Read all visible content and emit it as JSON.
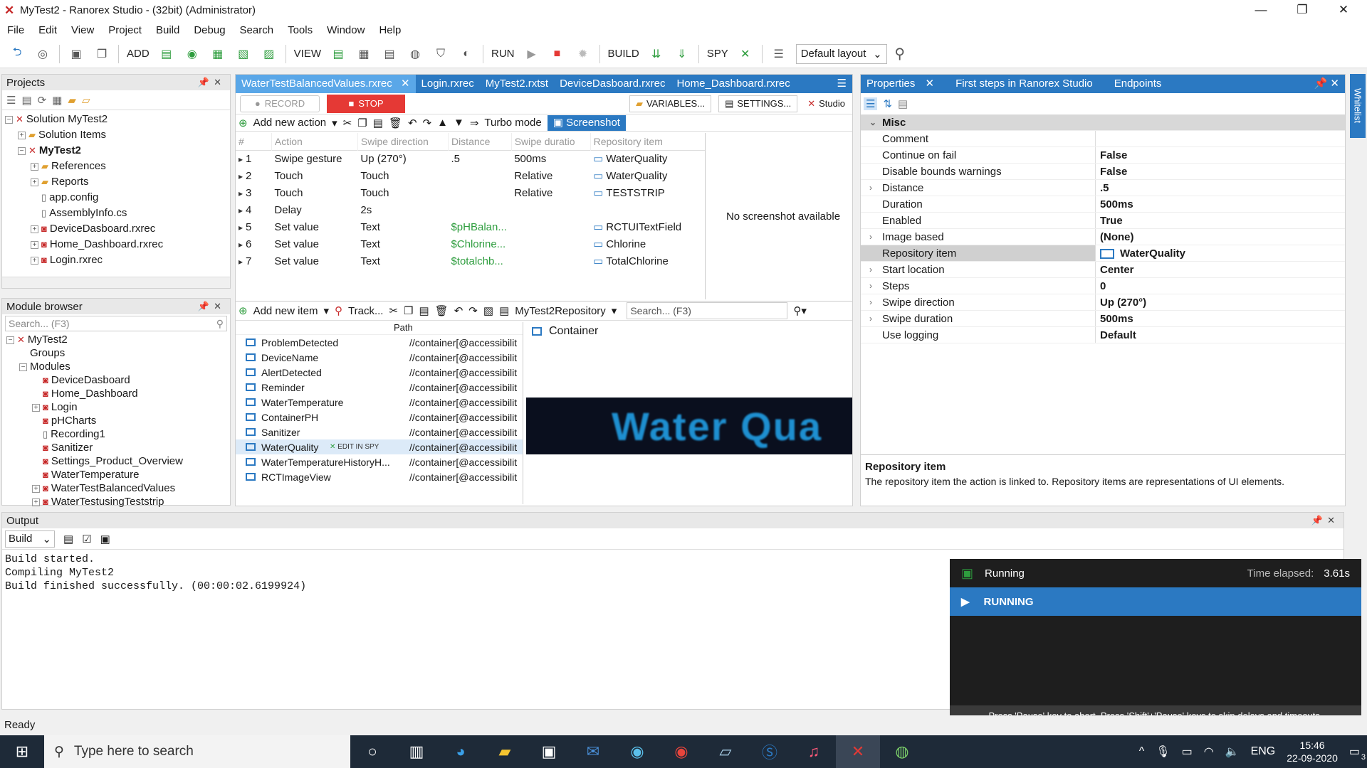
{
  "window": {
    "title": "MyTest2 - Ranorex Studio - (32bit) (Administrator)",
    "app_icon": "ranorex-icon"
  },
  "menu": [
    "File",
    "Edit",
    "View",
    "Project",
    "Build",
    "Debug",
    "Search",
    "Tools",
    "Window",
    "Help"
  ],
  "toolbar": {
    "add": "ADD",
    "view": "VIEW",
    "run": "RUN",
    "build": "BUILD",
    "spy": "SPY",
    "layout": "Default layout"
  },
  "projects": {
    "header": "Projects",
    "tree": [
      {
        "label": "Solution MyTest2",
        "indent": 0,
        "icon": "solution",
        "exp": "−",
        "bold": false
      },
      {
        "label": "Solution Items",
        "indent": 1,
        "icon": "folder",
        "exp": "+",
        "bold": false
      },
      {
        "label": "MyTest2",
        "indent": 1,
        "icon": "project",
        "exp": "−",
        "bold": true
      },
      {
        "label": "References",
        "indent": 2,
        "icon": "folder",
        "exp": "+",
        "bold": false
      },
      {
        "label": "Reports",
        "indent": 2,
        "icon": "folder",
        "exp": "+",
        "bold": false
      },
      {
        "label": "app.config",
        "indent": 2,
        "icon": "file",
        "exp": "",
        "bold": false
      },
      {
        "label": "AssemblyInfo.cs",
        "indent": 2,
        "icon": "file",
        "exp": "",
        "bold": false
      },
      {
        "label": "DeviceDasboard.rxrec",
        "indent": 2,
        "icon": "rec",
        "exp": "+",
        "bold": false
      },
      {
        "label": "Home_Dashboard.rxrec",
        "indent": 2,
        "icon": "rec",
        "exp": "+",
        "bold": false
      },
      {
        "label": "Login.rxrec",
        "indent": 2,
        "icon": "rec",
        "exp": "+",
        "bold": false
      }
    ]
  },
  "module_browser": {
    "header": "Module browser",
    "search_placeholder": "Search... (F3)",
    "tree": [
      {
        "label": "MyTest2",
        "indent": 0,
        "exp": "−",
        "icon": "project"
      },
      {
        "label": "Groups",
        "indent": 1,
        "exp": "",
        "icon": ""
      },
      {
        "label": "Modules",
        "indent": 1,
        "exp": "−",
        "icon": ""
      },
      {
        "label": "DeviceDasboard",
        "indent": 2,
        "exp": "",
        "icon": "rec"
      },
      {
        "label": "Home_Dashboard",
        "indent": 2,
        "exp": "",
        "icon": "rec"
      },
      {
        "label": "Login",
        "indent": 2,
        "exp": "+",
        "icon": "rec"
      },
      {
        "label": "pHCharts",
        "indent": 2,
        "exp": "",
        "icon": "rec"
      },
      {
        "label": "Recording1",
        "indent": 2,
        "exp": "",
        "icon": "file"
      },
      {
        "label": "Sanitizer",
        "indent": 2,
        "exp": "",
        "icon": "rec"
      },
      {
        "label": "Settings_Product_Overview",
        "indent": 2,
        "exp": "",
        "icon": "rec"
      },
      {
        "label": "WaterTemperature",
        "indent": 2,
        "exp": "",
        "icon": "rec"
      },
      {
        "label": "WaterTestBalancedValues",
        "indent": 2,
        "exp": "+",
        "icon": "rec"
      },
      {
        "label": "WaterTestusingTeststrip",
        "indent": 2,
        "exp": "+",
        "icon": "rec"
      }
    ]
  },
  "editor_tabs": [
    "WaterTestBalancedValues.rxrec",
    "Login.rxrec",
    "MyTest2.rxtst",
    "DeviceDasboard.rxrec",
    "Home_Dashboard.rxrec"
  ],
  "record_bar": {
    "record": "RECORD",
    "stop": "STOP",
    "variables": "VARIABLES...",
    "settings": "SETTINGS...",
    "studio": "Studio"
  },
  "action_bar": {
    "add_action": "Add new action",
    "turbo": "Turbo mode",
    "screenshot": "Screenshot"
  },
  "actions": {
    "columns": [
      "#",
      "Action",
      "Swipe direction",
      "Distance",
      "Swipe duratio",
      "Repository item"
    ],
    "rows": [
      {
        "n": "1",
        "action": "Swipe gesture",
        "p1": "Up (270°)",
        "p2": ".5",
        "p3": "500ms",
        "repo": "WaterQuality"
      },
      {
        "n": "2",
        "action": "Touch",
        "p1": "Touch",
        "p2": "",
        "p3": "Relative",
        "repo": "WaterQuality"
      },
      {
        "n": "3",
        "action": "Touch",
        "p1": "Touch",
        "p2": "",
        "p3": "Relative",
        "repo": "TESTSTRIP"
      },
      {
        "n": "4",
        "action": "Delay",
        "p1": "2s",
        "p2": "",
        "p3": "",
        "repo": ""
      },
      {
        "n": "5",
        "action": "Set value",
        "p1": "Text",
        "p2": "$pHBalan...",
        "p3": "",
        "repo": "RCTUITextField"
      },
      {
        "n": "6",
        "action": "Set value",
        "p1": "Text",
        "p2": "$Chlorine...",
        "p3": "",
        "repo": "Chlorine"
      },
      {
        "n": "7",
        "action": "Set value",
        "p1": "Text",
        "p2": "$totalchb...",
        "p3": "",
        "repo": "TotalChlorine"
      }
    ],
    "no_screenshot": "No screenshot available"
  },
  "repo_bar": {
    "add_item": "Add new item",
    "track": "Track...",
    "repo_name": "MyTest2Repository",
    "search_placeholder": "Search... (F3)"
  },
  "repo": {
    "path_header": "Path",
    "items": [
      {
        "name": "ProblemDetected",
        "path": "//container[@accessibilit"
      },
      {
        "name": "DeviceName",
        "path": "//container[@accessibilit"
      },
      {
        "name": "AlertDetected",
        "path": "//container[@accessibilit"
      },
      {
        "name": "Reminder",
        "path": "//container[@accessibilit"
      },
      {
        "name": "WaterTemperature",
        "path": "//container[@accessibilit"
      },
      {
        "name": "ContainerPH",
        "path": "//container[@accessibilit"
      },
      {
        "name": "Sanitizer",
        "path": "//container[@accessibilit"
      },
      {
        "name": "WaterQuality",
        "path": "//container[@accessibilit"
      },
      {
        "name": "WaterTemperatureHistoryH...",
        "path": "//container[@accessibilit"
      },
      {
        "name": "RCTImageView",
        "path": "//container[@accessibilit"
      }
    ],
    "edit_in_spy": "EDIT IN SPY",
    "preview_title": "Container",
    "preview_text": "Water Qua"
  },
  "properties": {
    "tabs": [
      "Properties",
      "First steps in Ranorex Studio",
      "Endpoints"
    ],
    "category": "Misc",
    "rows": [
      {
        "k": "Comment",
        "v": "",
        "exp": false
      },
      {
        "k": "Continue on fail",
        "v": "False",
        "exp": false
      },
      {
        "k": "Disable bounds warnings",
        "v": "False",
        "exp": false
      },
      {
        "k": "Distance",
        "v": ".5",
        "exp": true
      },
      {
        "k": "Duration",
        "v": "500ms",
        "exp": false
      },
      {
        "k": "Enabled",
        "v": "True",
        "exp": false
      },
      {
        "k": "Image based",
        "v": "(None)",
        "exp": true
      },
      {
        "k": "Repository item",
        "v": "WaterQuality",
        "exp": false,
        "sel": true
      },
      {
        "k": "Start location",
        "v": "Center",
        "exp": true
      },
      {
        "k": "Steps",
        "v": "0",
        "exp": true
      },
      {
        "k": "Swipe direction",
        "v": "Up (270°)",
        "exp": true
      },
      {
        "k": "Swipe duration",
        "v": "500ms",
        "exp": true
      },
      {
        "k": "Use logging",
        "v": "Default",
        "exp": false
      }
    ],
    "desc_title": "Repository item",
    "desc_text": "The repository item the action is linked to. Repository items are representations of UI elements."
  },
  "side_tab": "Whitelist",
  "output": {
    "header": "Output",
    "source": "Build",
    "lines": [
      "Build started.",
      "Compiling MyTest2",
      "Build finished successfully. (00:00:02.6199924)"
    ]
  },
  "runner": {
    "status": "Running",
    "elapsed_label": "Time elapsed:",
    "elapsed": "3.61s",
    "banner": "RUNNING",
    "hint": "Press 'Pause' key to abort. Press 'Shift'+'Pause' keys to skip delays and timeouts."
  },
  "statusbar": {
    "text": "Ready"
  },
  "taskbar": {
    "search_placeholder": "Type here to search",
    "lang": "ENG",
    "time": "15:46",
    "date": "22-09-2020",
    "notif": "3"
  },
  "colors": {
    "accent": "#2b79c2",
    "run_banner": "#2b79c2",
    "taskbar": "#1e2a38"
  }
}
